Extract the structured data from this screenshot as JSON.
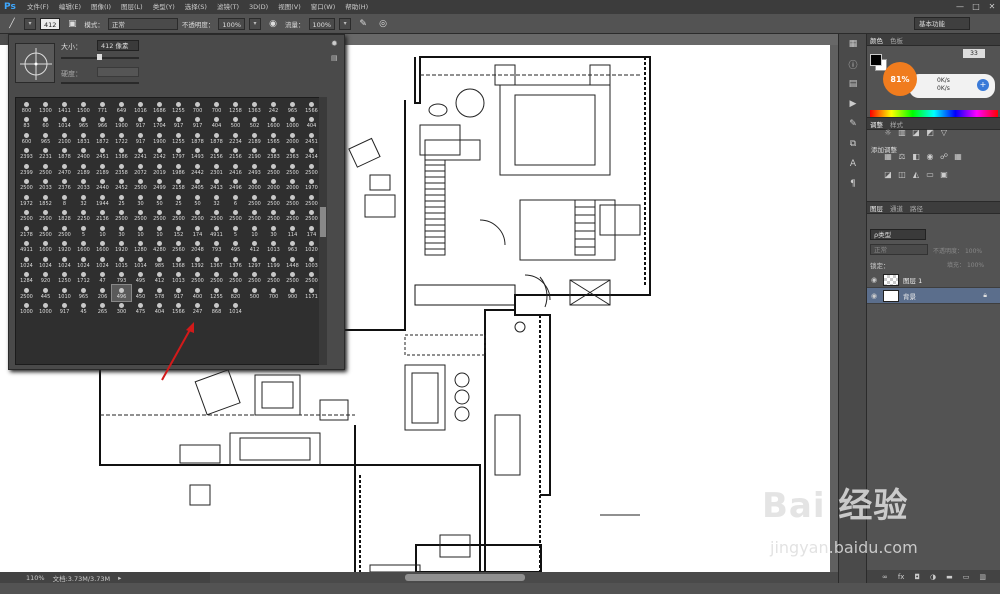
{
  "app": {
    "logo": "Ps"
  },
  "menu": [
    "文件(F)",
    "编辑(E)",
    "图像(I)",
    "图层(L)",
    "类型(Y)",
    "选择(S)",
    "滤镜(T)",
    "3D(D)",
    "视图(V)",
    "窗口(W)",
    "帮助(H)"
  ],
  "window_controls": [
    "—",
    "□",
    "✕"
  ],
  "options": {
    "brush_size": "412",
    "mode_label": "模式：",
    "mode_value": "正常",
    "opacity_label": "不透明度：",
    "opacity_value": "100%",
    "flow_label": "流量：",
    "flow_value": "100%",
    "workspace": "基本功能"
  },
  "brush_picker": {
    "size_label": "大小：",
    "size_value": "412 像素",
    "hardness_label": "硬度："
  },
  "brush_presets": [
    "800",
    "1300",
    "1411",
    "1500",
    "771",
    "649",
    "1016",
    "1686",
    "1255",
    "700",
    "700",
    "1258",
    "1363",
    "242",
    "965",
    "1566",
    "83",
    "60",
    "1014",
    "965",
    "966",
    "1900",
    "917",
    "1704",
    "917",
    "917",
    "404",
    "500",
    "502",
    "1600",
    "1000",
    "404",
    "600",
    "965",
    "2100",
    "1831",
    "1872",
    "1722",
    "917",
    "1900",
    "1255",
    "1878",
    "1878",
    "2234",
    "2189",
    "1565",
    "2000",
    "2451",
    "2393",
    "2231",
    "1878",
    "2400",
    "2451",
    "1386",
    "2241",
    "2142",
    "1797",
    "1493",
    "2156",
    "2156",
    "2190",
    "2383",
    "2363",
    "2414",
    "2399",
    "2500",
    "2470",
    "2189",
    "2189",
    "2358",
    "2072",
    "2019",
    "1986",
    "2442",
    "2301",
    "2416",
    "2493",
    "2500",
    "2500",
    "2500",
    "2500",
    "2033",
    "2376",
    "2033",
    "2440",
    "2452",
    "2500",
    "2499",
    "2158",
    "2405",
    "2413",
    "2496",
    "2000",
    "2000",
    "2000",
    "1970",
    "1972",
    "1852",
    "8",
    "32",
    "1944",
    "25",
    "30",
    "50",
    "25",
    "50",
    "32",
    "6",
    "2500",
    "2500",
    "2500",
    "2500",
    "2500",
    "2500",
    "1828",
    "2250",
    "2136",
    "2500",
    "2500",
    "2500",
    "2500",
    "2500",
    "2500",
    "2500",
    "2500",
    "2500",
    "2500",
    "2500",
    "2178",
    "2500",
    "2500",
    "5",
    "10",
    "30",
    "10",
    "10",
    "152",
    "174",
    "4911",
    "5",
    "10",
    "30",
    "114",
    "174",
    "4911",
    "1600",
    "1920",
    "1600",
    "1600",
    "1920",
    "1280",
    "4280",
    "2560",
    "2048",
    "793",
    "495",
    "412",
    "1013",
    "963",
    "1020",
    "1024",
    "1024",
    "1024",
    "1024",
    "1024",
    "1015",
    "1014",
    "985",
    "1368",
    "1392",
    "1367",
    "1376",
    "1297",
    "1199",
    "1448",
    "1003",
    "1284",
    "920",
    "1250",
    "1712",
    "47",
    "793",
    "495",
    "412",
    "1013",
    "2500",
    "2500",
    "2500",
    "2500",
    "2500",
    "2500",
    "2500",
    "2500",
    "445",
    "1010",
    "965",
    "206",
    "496",
    "450",
    "578",
    "917",
    "400",
    "1255",
    "820",
    "500",
    "700",
    "900",
    "1171",
    "1000",
    "1000",
    "917",
    "45",
    "265",
    "300",
    "475",
    "404",
    "1566",
    "247",
    "868",
    "1014"
  ],
  "brush_selected_index": 197,
  "color_panel": {
    "tabs": [
      "颜色",
      "色板"
    ],
    "r_value": "33",
    "net_percent": "81%",
    "net_up": "0K/s",
    "net_down": "0K/s"
  },
  "adjust_panel": {
    "tabs": [
      "调整",
      "样式"
    ],
    "title": "添加调整"
  },
  "layers_panel": {
    "tabs": [
      "图层",
      "通道",
      "路径"
    ],
    "kind": "ρ类型",
    "blend": "正常",
    "opacity_label": "不透明度：",
    "opacity_value": "100%",
    "lock_label": "锁定：",
    "fill_label": "填充：",
    "fill_value": "100%",
    "layers": [
      {
        "name": "图层 1",
        "selected": false
      },
      {
        "name": "背景",
        "selected": true
      }
    ]
  },
  "status": {
    "zoom": "110%",
    "doc": "文档:3.73M/3.73M"
  },
  "watermark": {
    "text": "Bai 经验",
    "url": "jingyan.baidu.com"
  },
  "colors": {
    "accent_badge": "#f07c1e",
    "pointer": "#d21a1a",
    "selected_layer": "#5b6e8c"
  }
}
